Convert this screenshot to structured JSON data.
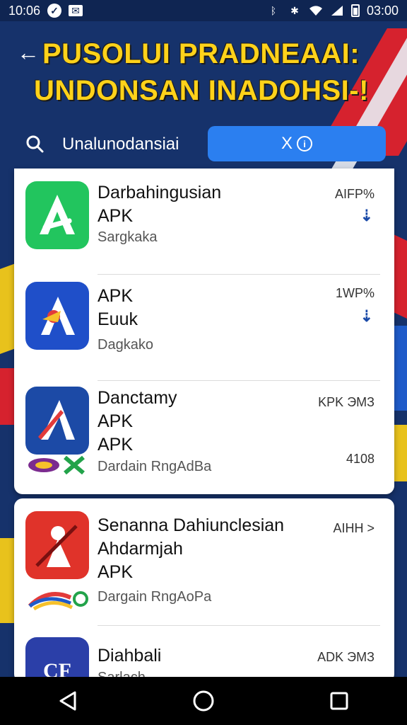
{
  "status_bar": {
    "time": "10:06",
    "clock_right": "03:00",
    "icons": [
      "check-circle-icon",
      "mail-icon",
      "bluetooth-icon",
      "settings-icon",
      "wifi-icon",
      "signal-icon",
      "battery-icon"
    ]
  },
  "header": {
    "title_line1": "PUSOLUI PRADNEAAI:",
    "title_line2": "UNDONSAN INADOHSI-!",
    "title_color": "#ffd21a"
  },
  "search": {
    "query": "Unalunodansiai",
    "clear_label": "X",
    "clear_icon": "info-circle-icon"
  },
  "apps": [
    {
      "title_lines": [
        "Darbahingusian",
        "APK"
      ],
      "subtitle": "Sargkaka",
      "meta": "AIFP%",
      "icon_bg": "#22c55e",
      "icon_glyph": "A"
    },
    {
      "title_lines": [
        "APK",
        "Euuk"
      ],
      "subtitle": "Dagkako",
      "meta": "1WP%",
      "icon_bg": "#1f4fc9",
      "icon_glyph": "A"
    },
    {
      "title_lines": [
        "Danctamy",
        "APK",
        "APK"
      ],
      "subtitle": "Dardain RngAdBa",
      "meta": "KPK ЭМЗ",
      "meta2": "4108",
      "icon_bg": "#1c4aa6",
      "icon_glyph": "A"
    },
    {
      "title_lines": [
        "Senanna Dahiunclesian",
        "Ahdarmjah",
        "APK"
      ],
      "subtitle": "Dargain RngAoPa",
      "meta": "AIHH >",
      "icon_bg": "#e0332a",
      "icon_glyph": "☗"
    },
    {
      "title_lines": [
        "Diahbali"
      ],
      "subtitle": "Sarlach",
      "meta": "ADK ЭМЗ",
      "icon_bg": "#2b3fa8",
      "icon_glyph": "CF"
    }
  ],
  "nav": {
    "back": "back-triangle-icon",
    "home": "home-circle-icon",
    "recents": "recents-square-icon"
  }
}
